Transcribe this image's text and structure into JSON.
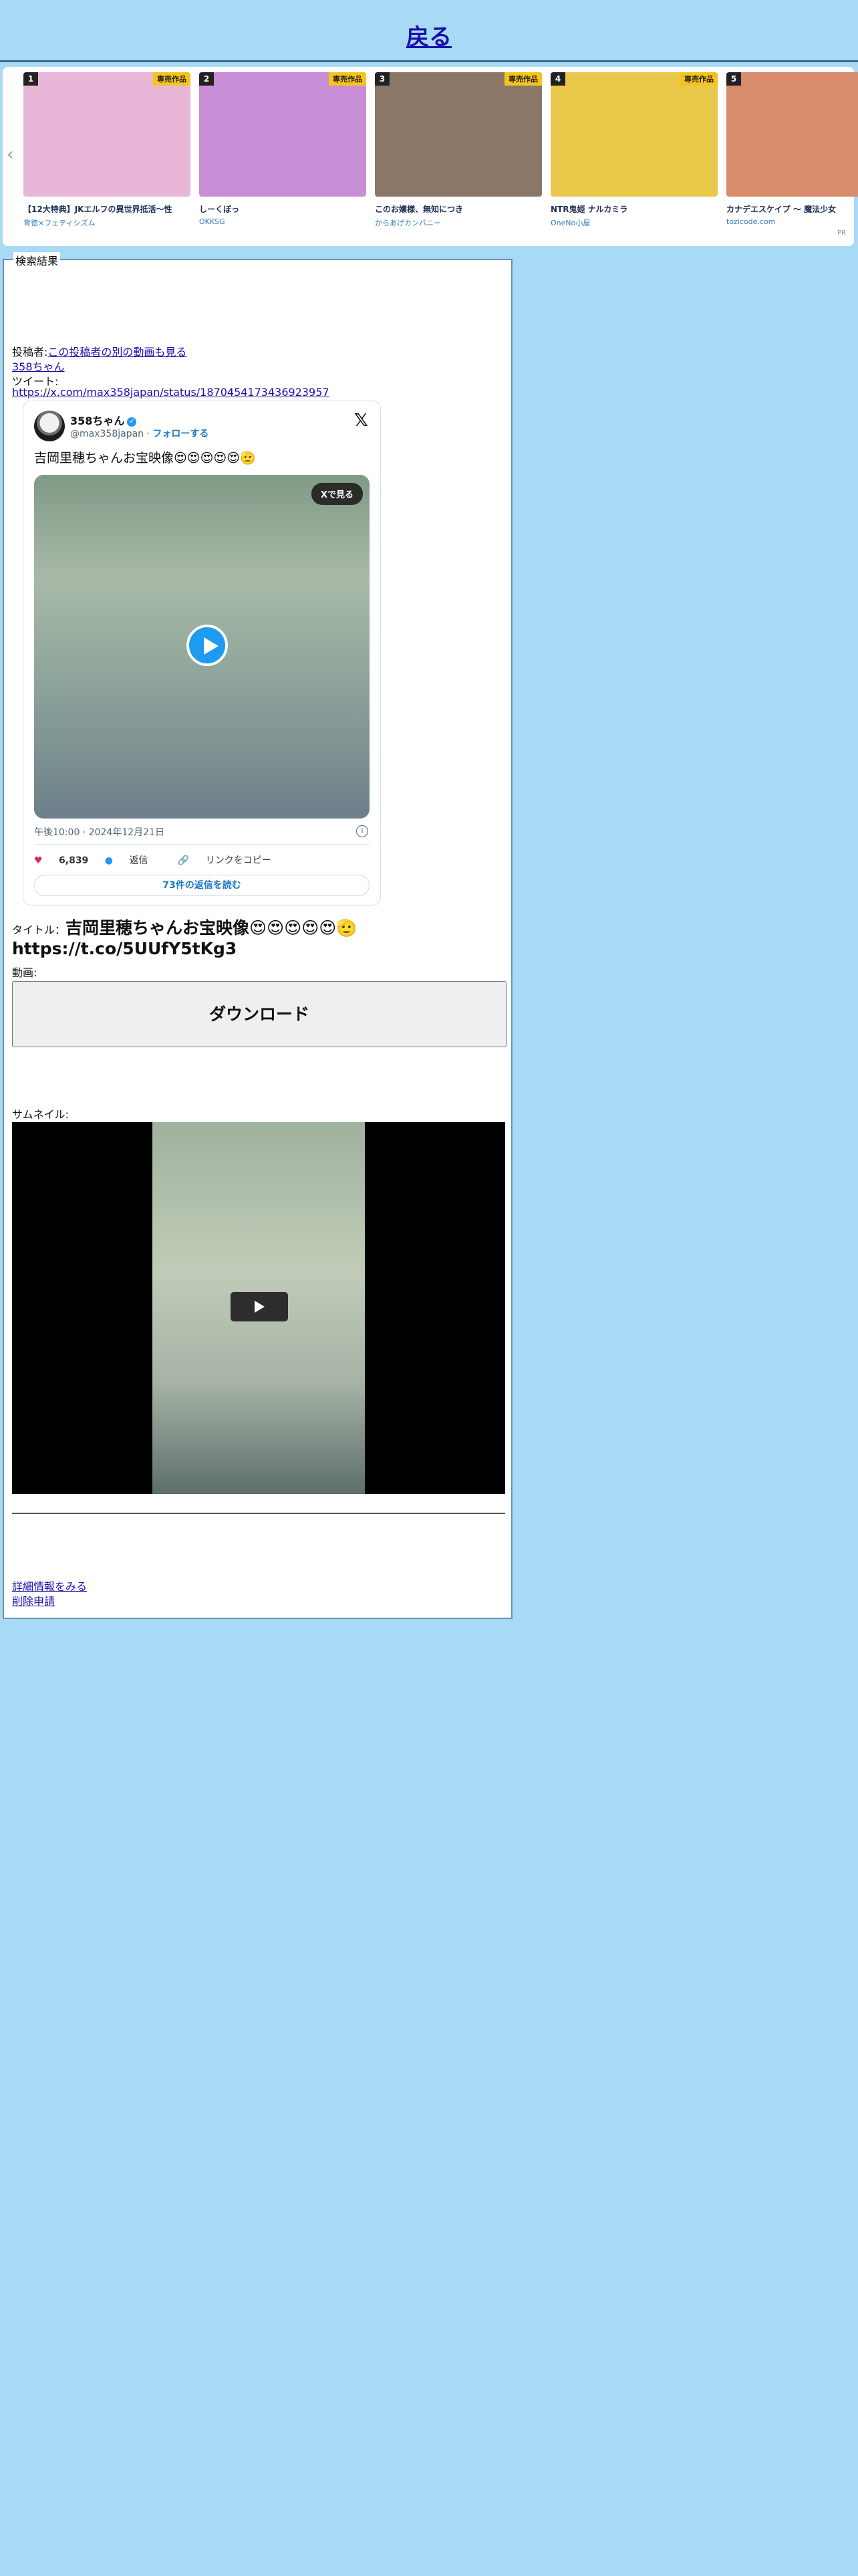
{
  "header": {
    "back_label": "戻る"
  },
  "carousel": {
    "pr_label": "PR",
    "items": [
      {
        "rank": "1",
        "badge": "専売作品",
        "title": "【12大特典】JKエルフの異世界抵活〜性",
        "sub": "背徳×フェティシズム",
        "color": "#e8b7d8"
      },
      {
        "rank": "2",
        "badge": "専売作品",
        "title": "しーくぼっ",
        "sub": "OKKSG",
        "color": "#c98fd6"
      },
      {
        "rank": "3",
        "badge": "専売作品",
        "title": "このお嬢様、無知につき",
        "sub": "からあげカンパニー",
        "color": "#8a7768"
      },
      {
        "rank": "4",
        "badge": "専売作品",
        "title": "NTR鬼姫 ナルカミラ",
        "sub": "OneNo小屋",
        "color": "#e9c84a"
      },
      {
        "rank": "5",
        "badge": "",
        "title": "カナデエスケイプ 〜 魔法少女",
        "sub": "tozicode.com",
        "color": "#d88c6c"
      }
    ]
  },
  "result": {
    "legend": "検索結果",
    "poster_label": "投稿者:",
    "poster_link": "この投稿者の別の動画も見る",
    "poster_name": "358ちゃん",
    "tweet_label": "ツイート:",
    "tweet_url": "https://x.com/max358japan/status/1870454173436923957",
    "title_label": "タイトル：",
    "title_text": "吉岡里穂ちゃんお宝映像😍😍😍😍😍🫡 https://t.co/5UUfY5tKg3",
    "video_label": "動画:",
    "download_label": "ダウンロード",
    "thumb_label": "サムネイル:",
    "details_link": "詳細情報をみる",
    "delete_link": "削除申請"
  },
  "tweet": {
    "name": "358ちゃん",
    "handle": "@max358japan",
    "follow": "フォローする",
    "text": "吉岡里穂ちゃんお宝映像😍😍😍😍😍🫡",
    "watch_label": "Xで見る",
    "date": "午後10:00 · 2024年12月21日",
    "likes": "6,839",
    "reply_label": "返信",
    "copy_label": "リンクをコピー",
    "replies_button": "73件の返信を読む"
  }
}
